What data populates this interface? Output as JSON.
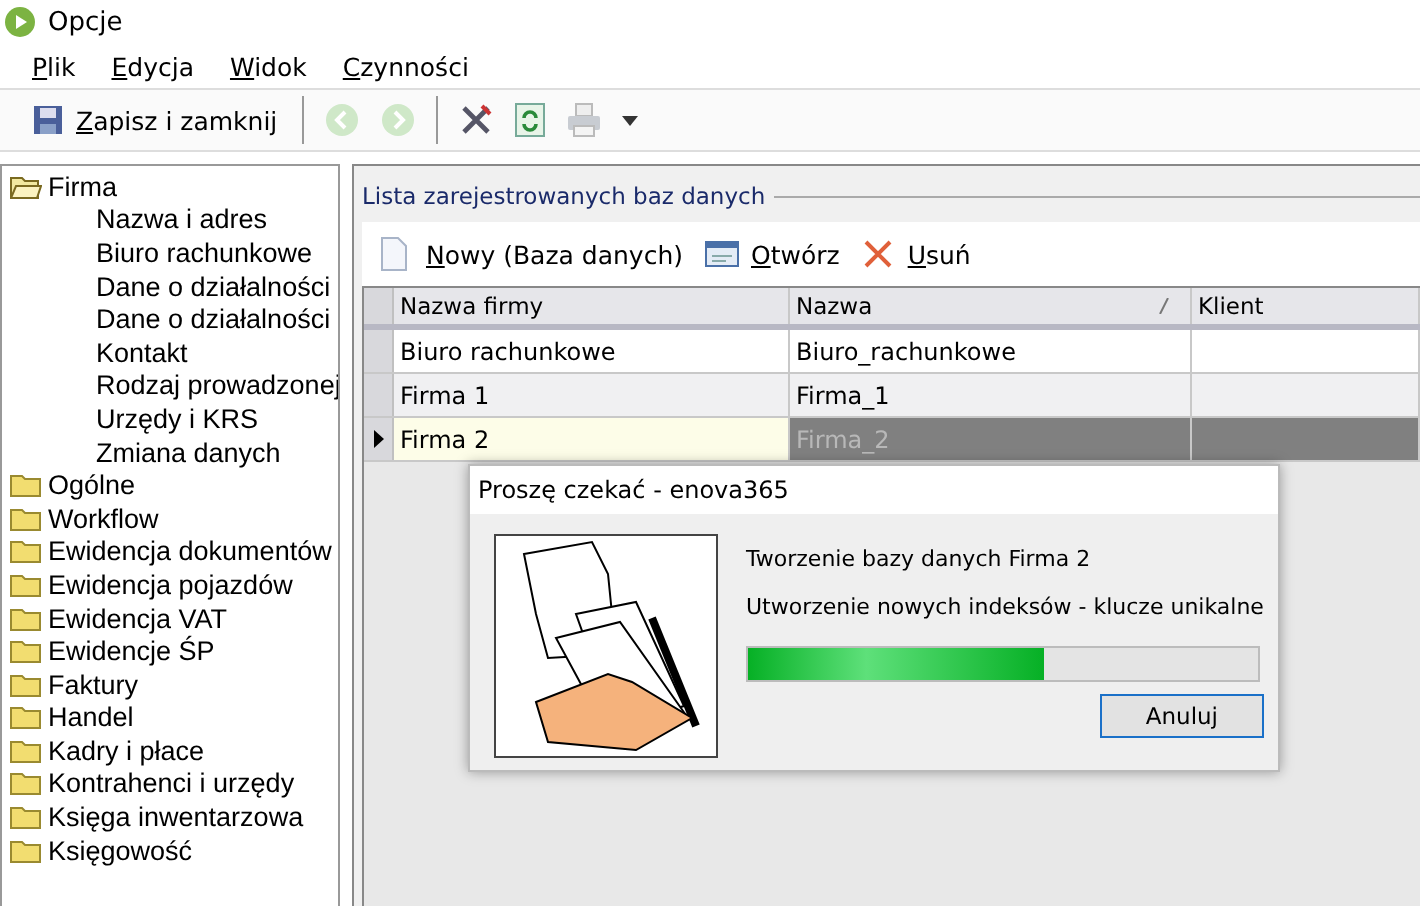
{
  "window": {
    "title": "Opcje"
  },
  "menu": [
    "Plik",
    "Edycja",
    "Widok",
    "Czynności"
  ],
  "toolbar": {
    "save_label": "Zapisz i zamknij"
  },
  "tree": [
    {
      "label": "Firma",
      "expanded": true,
      "children": [
        {
          "label": "Nazwa i adres"
        },
        {
          "label": "Biuro rachunkowe"
        },
        {
          "label": "Dane o działalności"
        },
        {
          "label": "Dane o działalności"
        },
        {
          "label": "Kontakt"
        },
        {
          "label": "Rodzaj prowadzonej"
        },
        {
          "label": "Urzędy i KRS"
        },
        {
          "label": "Zmiana danych"
        }
      ]
    },
    {
      "label": "Ogólne",
      "expanded": false
    },
    {
      "label": "Workflow",
      "expanded": false
    },
    {
      "label": "Ewidencja dokumentów",
      "expanded": false
    },
    {
      "label": "Ewidencja pojazdów",
      "expanded": false
    },
    {
      "label": "Ewidencja VAT",
      "expanded": false
    },
    {
      "label": "Ewidencje ŚP",
      "expanded": false
    },
    {
      "label": "Faktury",
      "expanded": false
    },
    {
      "label": "Handel",
      "expanded": false
    },
    {
      "label": "Kadry i płace",
      "expanded": false
    },
    {
      "label": "Kontrahenci i urzędy",
      "expanded": false
    },
    {
      "label": "Księga inwentarzowa",
      "expanded": false
    },
    {
      "label": "Księgowość",
      "expanded": false
    }
  ],
  "group": {
    "title": "Lista zarejestrowanych baz danych"
  },
  "actions": [
    {
      "kind": "new",
      "label": "Nowy (Baza danych)"
    },
    {
      "kind": "open",
      "label": "Otwórz"
    },
    {
      "kind": "delete",
      "label": "Usuń"
    }
  ],
  "table": {
    "columns": [
      "Nazwa firmy",
      "Nazwa",
      "Klient"
    ],
    "rows": [
      {
        "cells": [
          "Biuro rachunkowe",
          "Biuro_rachunkowe",
          ""
        ],
        "selected": false
      },
      {
        "cells": [
          "Firma 1",
          "Firma_1",
          ""
        ],
        "selected": false
      },
      {
        "cells": [
          "Firma 2",
          "Firma_2",
          ""
        ],
        "selected": true
      }
    ]
  },
  "dialog": {
    "title": "Proszę czekać - enova365",
    "message": "Tworzenie bazy danych Firma 2",
    "step": "Utworzenie nowych indeksów - klucze unikalne",
    "level": 0.58,
    "button": "Anuluj"
  }
}
